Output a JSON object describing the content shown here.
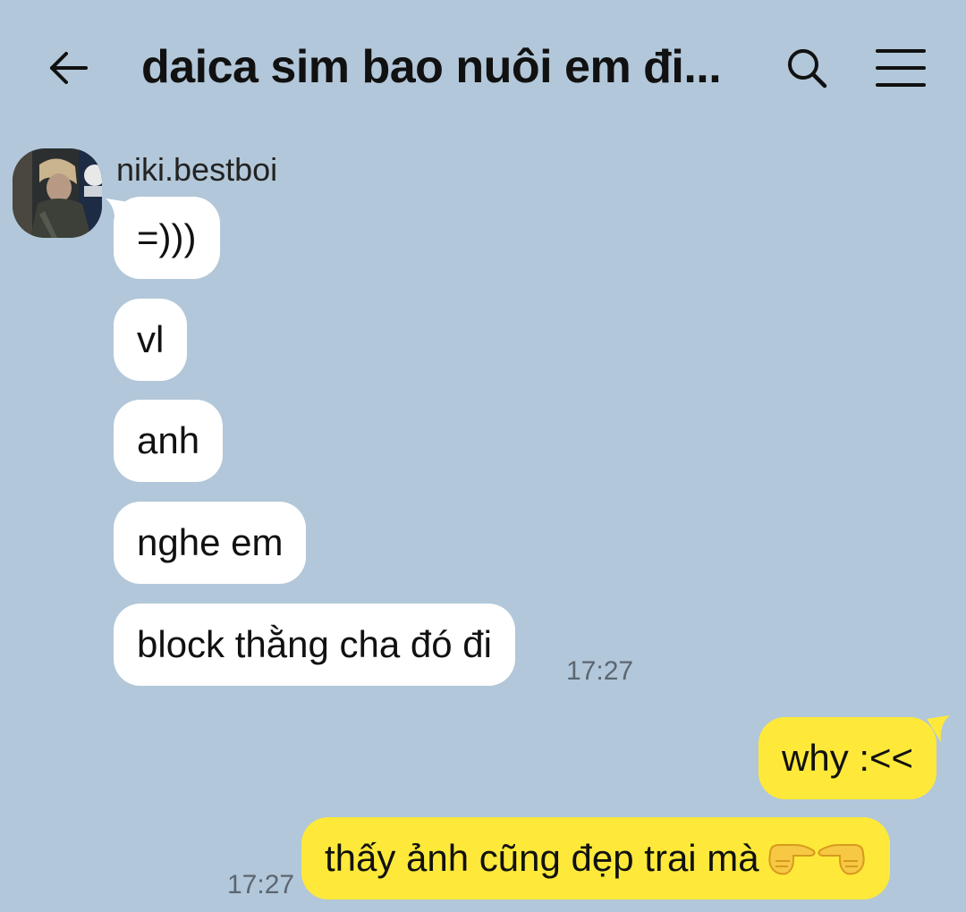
{
  "header": {
    "title": "daica sim bao nuôi em đi...",
    "back_icon": "arrow-left-icon",
    "search_icon": "search-icon",
    "menu_icon": "hamburger-menu-icon"
  },
  "sender": {
    "name": "niki.bestboi"
  },
  "incoming_messages": [
    {
      "text": "=)))"
    },
    {
      "text": "vl"
    },
    {
      "text": "anh"
    },
    {
      "text": "nghe em"
    },
    {
      "text": "block thằng cha đó đi",
      "time": "17:27"
    }
  ],
  "outgoing_messages": [
    {
      "text": "why :<<"
    },
    {
      "text": "thấy ảnh cũng đẹp trai mà",
      "time": "17:27",
      "emoji": [
        "backhand-pointing-right",
        "backhand-pointing-left"
      ]
    }
  ],
  "colors": {
    "background": "#b2c7d9",
    "incoming_bubble": "#ffffff",
    "outgoing_bubble": "#fee93a"
  }
}
